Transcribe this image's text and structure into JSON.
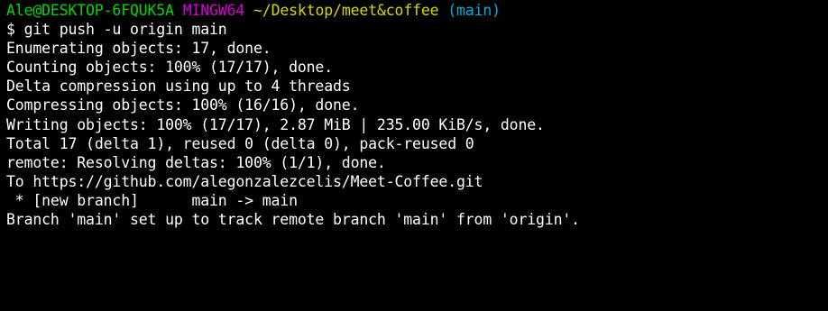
{
  "prompt": {
    "user_host": "Ale@DESKTOP-6FQUK5A",
    "system": "MINGW64",
    "path": "~/Desktop/meet&coffee",
    "branch": "(main)"
  },
  "command": "$ git push -u origin main",
  "output": [
    "Enumerating objects: 17, done.",
    "Counting objects: 100% (17/17), done.",
    "Delta compression using up to 4 threads",
    "Compressing objects: 100% (16/16), done.",
    "Writing objects: 100% (17/17), 2.87 MiB | 235.00 KiB/s, done.",
    "Total 17 (delta 1), reused 0 (delta 0), pack-reused 0",
    "remote: Resolving deltas: 100% (1/1), done.",
    "To https://github.com/alegonzalezcelis/Meet-Coffee.git",
    " * [new branch]      main -> main",
    "Branch 'main' set up to track remote branch 'main' from 'origin'."
  ],
  "colors": {
    "background": "#000000",
    "text": "#ffffff",
    "user_host": "#00d700",
    "system": "#d700d7",
    "path": "#d7d700",
    "branch": "#00afd7"
  }
}
